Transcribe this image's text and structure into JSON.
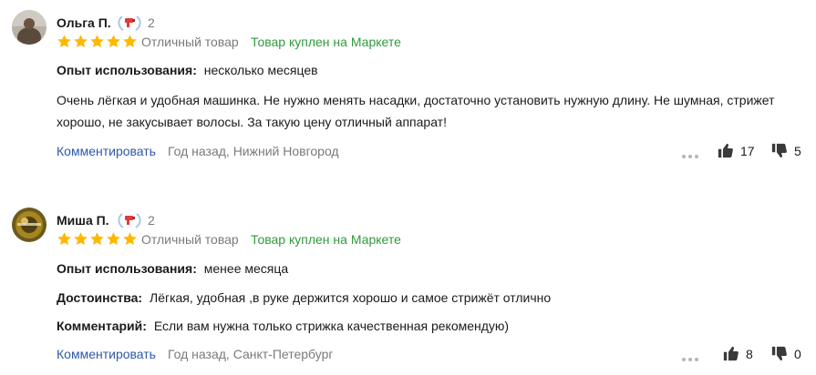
{
  "reviews": [
    {
      "author": "Ольга П.",
      "badge_count": "2",
      "rating_label": "Отличный товар",
      "purchased_label": "Товар куплен на Маркете",
      "fields": [
        {
          "label": "Опыт использования:",
          "value": "несколько месяцев"
        }
      ],
      "text_lines": [
        "Очень лёгкая и удобная машинка. Не нужно менять насадки, достаточно установить нужную длину. Не шумная, стрижет",
        "хорошо, не закусывает волосы. За такую цену отличный аппарат!"
      ],
      "comment_label": "Комментировать",
      "meta": "Год назад, Нижний Новгород",
      "likes": "17",
      "dislikes": "5"
    },
    {
      "author": "Миша П.",
      "badge_count": "2",
      "rating_label": "Отличный товар",
      "purchased_label": "Товар куплен на Маркете",
      "fields": [
        {
          "label": "Опыт использования:",
          "value": "менее месяца"
        },
        {
          "label": "Достоинства:",
          "value": "Лёгкая, удобная ,в руке держится хорошо и самое стрижёт отлично"
        },
        {
          "label": "Комментарий:",
          "value": "Если вам нужна только стрижка качественная рекомендую)"
        }
      ],
      "comment_label": "Комментировать",
      "meta": "Год назад, Санкт-Петербург",
      "likes": "8",
      "dislikes": "0"
    }
  ],
  "colors": {
    "star": "#ffb800",
    "purchased": "#2e9b3c",
    "link": "#2d59a8",
    "muted": "#7a7a7a"
  },
  "icons": {
    "badge": "laurel-hairdryer-badge-icon",
    "like": "thumbs-up-icon",
    "dislike": "thumbs-down-icon",
    "more": "more-dots-icon"
  }
}
